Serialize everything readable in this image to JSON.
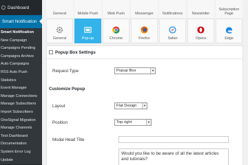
{
  "sidebar": {
    "dashboard": "Dashboard",
    "active": "Smart Notification",
    "items": [
      "Smart Notification",
      "New Campaign",
      "Campaigns Pending",
      "Campaigns Archive",
      "Auto Campaigns",
      "RSS Auto Push",
      "Statistics",
      "Event Manager",
      "Manage Connections",
      "Manage Subscribers",
      "Import Subscribers",
      "OneSignal Migration",
      "Manage Channels",
      "Test Dashboard",
      "Documentation",
      "System Error Log",
      "Update"
    ]
  },
  "tabs_row1": [
    {
      "label": "General"
    },
    {
      "label": "Mobile Push"
    },
    {
      "label": "Web Push"
    },
    {
      "label": "Messenger"
    },
    {
      "label": "Notifications"
    },
    {
      "label": "Newsletter"
    },
    {
      "label": "Subscription Page"
    }
  ],
  "tabs_row2": [
    {
      "label": "General",
      "icon": "gear-icon"
    },
    {
      "label": "Pop-up",
      "icon": "popup-icon"
    },
    {
      "label": "Chrome",
      "icon": "chrome-icon"
    },
    {
      "label": "Firefox",
      "icon": "firefox-icon"
    },
    {
      "label": "Safari",
      "icon": "safari-icon"
    },
    {
      "label": "Opera",
      "icon": "opera-icon"
    },
    {
      "label": "Edge",
      "icon": "edge-icon"
    }
  ],
  "panel": {
    "title": "Popup Box Settings",
    "request_type_label": "Request Type",
    "request_type_value": "Popup Box",
    "customize_title": "Customize Popup",
    "layout_label": "Layout",
    "layout_value": "Flat Design",
    "position_label": "Position",
    "position_value": "Top right",
    "head_title_label": "Modal Head Title",
    "head_title_value": "",
    "message_value": "Would you like to be aware of all the latest articles and tutorials?"
  },
  "colors": {
    "sidebar_bg": "#23282d",
    "active_bg": "#0073aa",
    "active_tab": "#33b3ea"
  }
}
